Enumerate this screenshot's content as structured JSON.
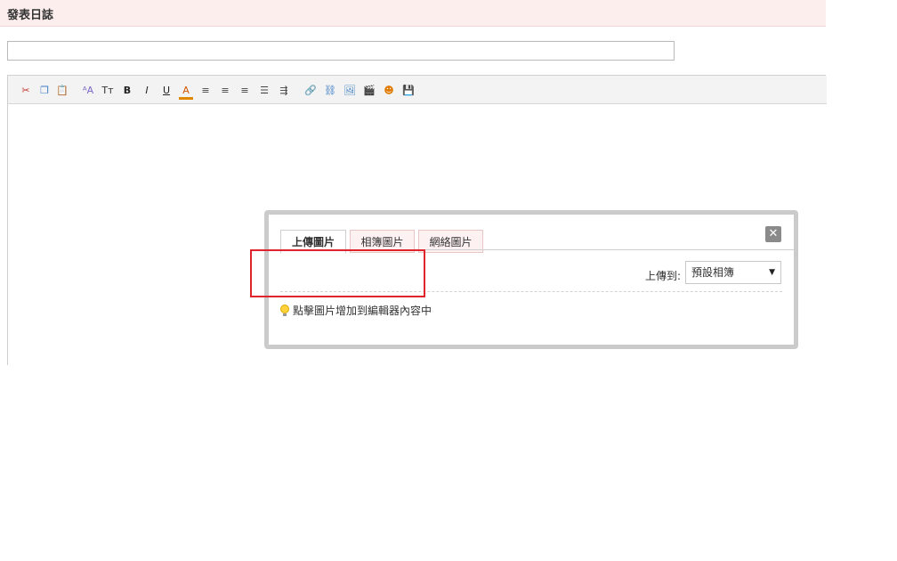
{
  "header": {
    "title": "發表日誌"
  },
  "subject": {
    "value": "",
    "placeholder": ""
  },
  "toolbar": {
    "buttons": [
      {
        "name": "cut-icon",
        "glyph": "✂",
        "color": "#c0392b"
      },
      {
        "name": "copy-icon",
        "glyph": "❐",
        "color": "#3b7dc4"
      },
      {
        "name": "paste-icon",
        "glyph": "📋",
        "color": "#8b5a2b"
      },
      {
        "name": "font-family-icon",
        "glyph": "ᴬA",
        "color": "#7b68c8"
      },
      {
        "name": "font-size-icon",
        "glyph": "Tт",
        "color": "#333333"
      },
      {
        "name": "bold-icon",
        "glyph": "B",
        "color": "#222222"
      },
      {
        "name": "italic-icon",
        "glyph": "I",
        "color": "#222222"
      },
      {
        "name": "underline-icon",
        "glyph": "U",
        "color": "#222222"
      },
      {
        "name": "font-color-icon",
        "glyph": "A",
        "color": "#d45500"
      },
      {
        "name": "align-left-icon",
        "glyph": "≡",
        "color": "#444444"
      },
      {
        "name": "align-center-icon",
        "glyph": "≡",
        "color": "#444444"
      },
      {
        "name": "align-right-icon",
        "glyph": "≡",
        "color": "#444444"
      },
      {
        "name": "ordered-list-icon",
        "glyph": "☰",
        "color": "#444444"
      },
      {
        "name": "indent-icon",
        "glyph": "⇶",
        "color": "#444444"
      },
      {
        "name": "insert-link-icon",
        "glyph": "🔗",
        "color": "#5a8f3c"
      },
      {
        "name": "unlink-icon",
        "glyph": "⛓",
        "color": "#3b7dc4"
      },
      {
        "name": "insert-image-icon",
        "glyph": "🖼",
        "color": "#3b7dc4"
      },
      {
        "name": "insert-video-icon",
        "glyph": "🎬",
        "color": "#333333"
      },
      {
        "name": "emoticon-icon",
        "glyph": "☻",
        "color": "#e07b00"
      },
      {
        "name": "save-icon",
        "glyph": "💾",
        "color": "#3b7dc4"
      }
    ]
  },
  "dialog": {
    "tabs": [
      {
        "label": "上傳圖片",
        "active": true
      },
      {
        "label": "相簿圖片",
        "active": false
      },
      {
        "label": "網絡圖片",
        "active": false
      }
    ],
    "close_glyph": "✕",
    "upload_to_label": "上傳到:",
    "album_selected": "預設相簿",
    "tip": "點擊圖片增加到編輯器內容中"
  }
}
